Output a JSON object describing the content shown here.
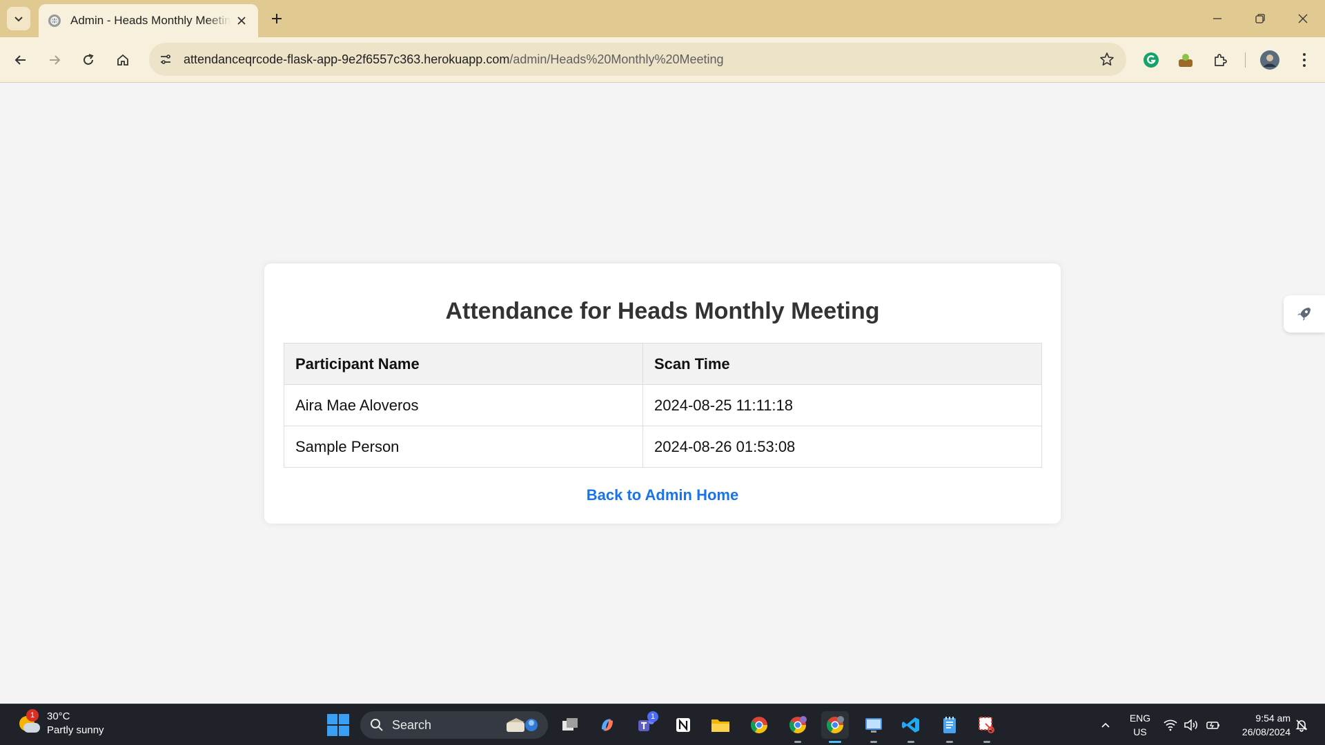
{
  "browser": {
    "tab_title": "Admin - Heads Monthly Meeting",
    "url_host": "attendanceqrcode-flask-app-9e2f6557c363.herokuapp.com",
    "url_path": "/admin/Heads%20Monthly%20Meeting"
  },
  "page": {
    "heading": "Attendance for Heads Monthly Meeting",
    "table": {
      "headers": [
        "Participant Name",
        "Scan Time"
      ],
      "rows": [
        [
          "Aira Mae Aloveros",
          "2024-08-25 11:11:18"
        ],
        [
          "Sample Person",
          "2024-08-26 01:53:08"
        ]
      ]
    },
    "back_link": "Back to Admin Home"
  },
  "taskbar": {
    "weather_temp": "30°C",
    "weather_desc": "Partly sunny",
    "weather_badge": "1",
    "search_label": "Search",
    "teams_badge": "1",
    "lang_line1": "ENG",
    "lang_line2": "US",
    "time": "9:54 am",
    "date": "26/08/2024"
  },
  "colors": {
    "tab_strip": "#e0ca92",
    "toolbar": "#f6f0dc",
    "page_bg": "#f4f4f4",
    "link": "#1a73e8",
    "taskbar": "#1f2329"
  },
  "icons": [
    "tab-list-icon",
    "globe-icon",
    "close-icon",
    "plus-icon",
    "minimize-icon",
    "restore-icon",
    "back-icon",
    "forward-icon",
    "reload-icon",
    "home-icon",
    "site-info-icon",
    "star-icon",
    "grammarly-icon",
    "extension-icon",
    "puzzle-icon",
    "profile-avatar",
    "menu-icon",
    "rocket-icon",
    "windows-start-icon",
    "search-icon",
    "wifi-icon",
    "volume-icon",
    "battery-icon",
    "notification-icon"
  ]
}
